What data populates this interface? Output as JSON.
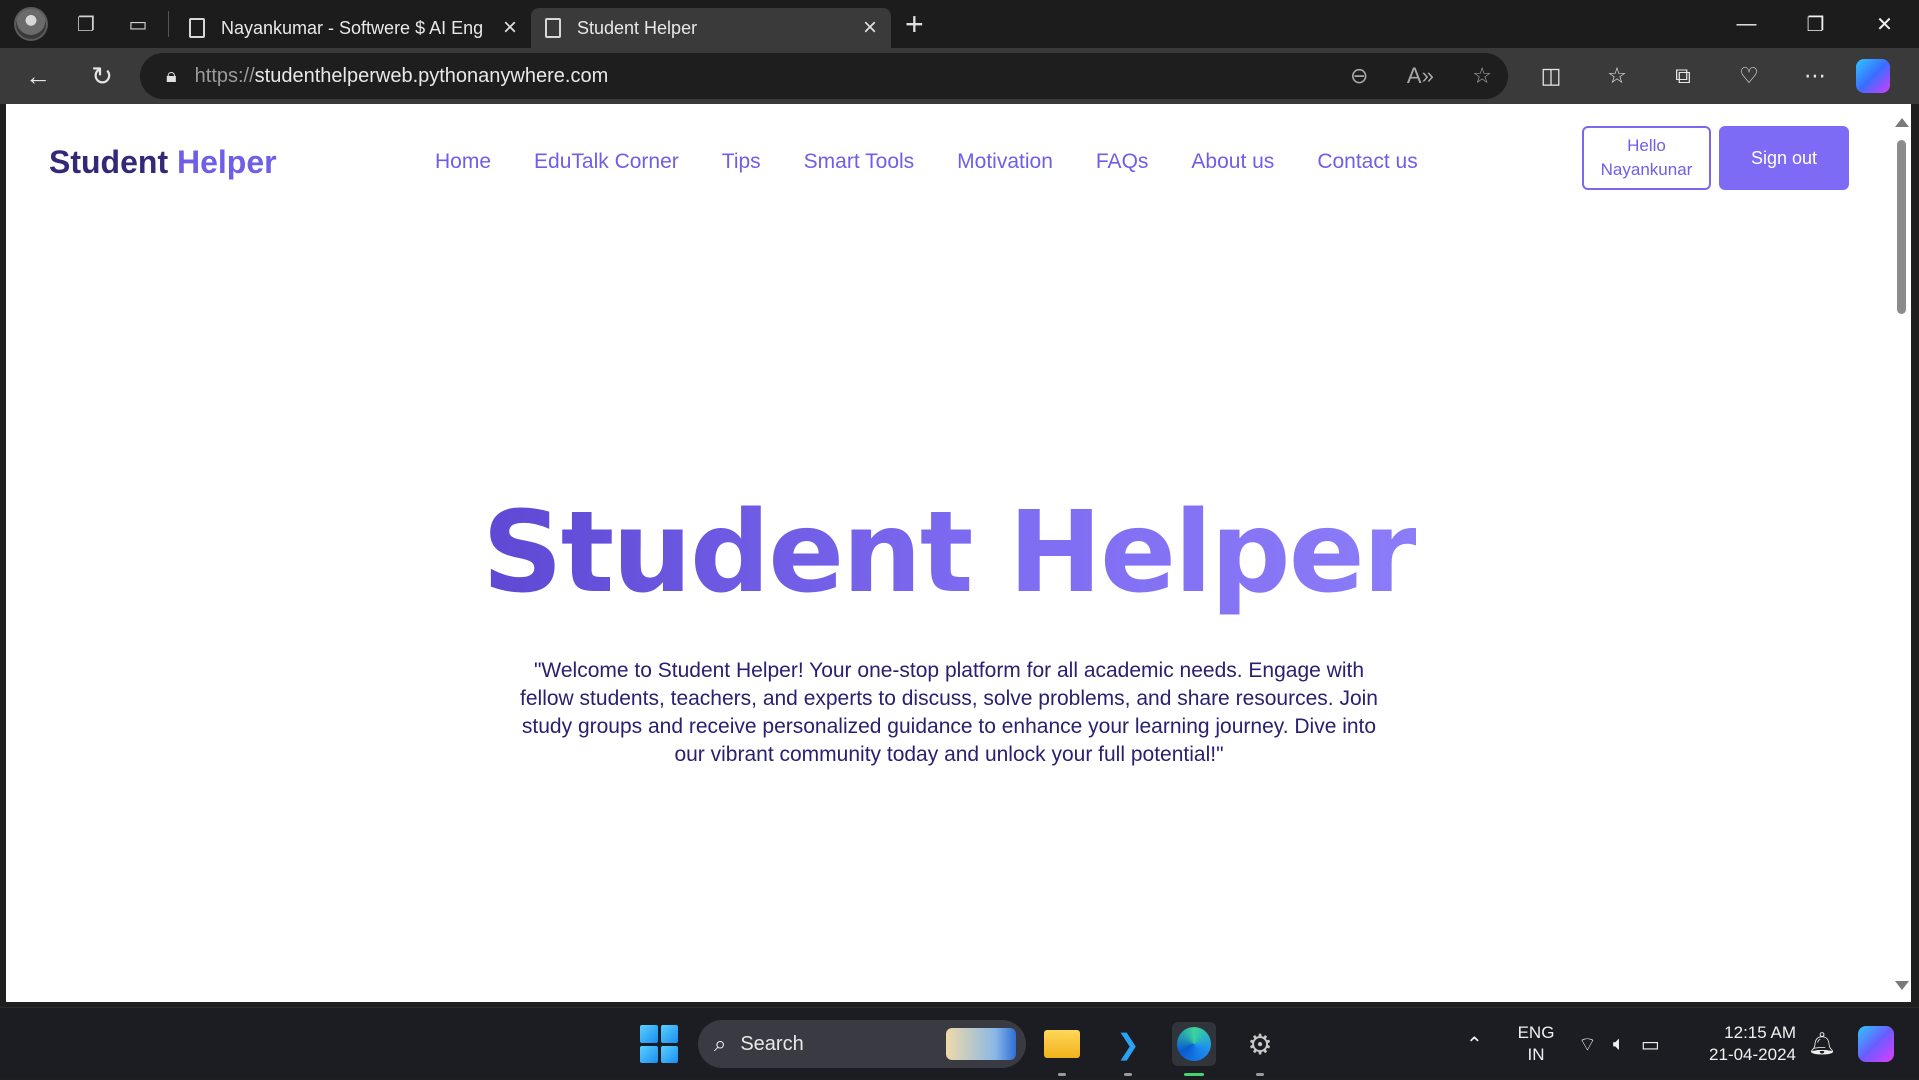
{
  "browser": {
    "tabs": [
      {
        "title": "Nayankumar - Softwere $ AI Eng"
      },
      {
        "title": "Student Helper"
      }
    ],
    "address": {
      "protocol": "https://",
      "host": "studenthelperweb.pythonanywhere.com"
    }
  },
  "page": {
    "brand": {
      "part1": "Student",
      "part2": "Helper"
    },
    "nav": [
      "Home",
      "EduTalk Corner",
      "Tips",
      "Smart Tools",
      "Motivation",
      "FAQs",
      "About us",
      "Contact us"
    ],
    "hello": {
      "line1": "Hello",
      "line2": "Nayankunar"
    },
    "signout_label": "Sign out",
    "hero_title": "Student Helper",
    "hero_text": "\"Welcome to Student Helper! Your one-stop platform for all academic needs. Engage with fellow students, teachers, and experts to discuss, solve problems, and share resources. Join study groups and receive personalized guidance to enhance your learning journey. Dive into our vibrant community today and unlock your full potential!\""
  },
  "taskbar": {
    "search_placeholder": "Search",
    "lang": {
      "line1": "ENG",
      "line2": "IN"
    },
    "time": "12:15 AM",
    "date": "21-04-2024"
  },
  "colors": {
    "brand_dark": "#34287a",
    "accent": "#6f5ee8",
    "button": "#7d6bf6"
  }
}
